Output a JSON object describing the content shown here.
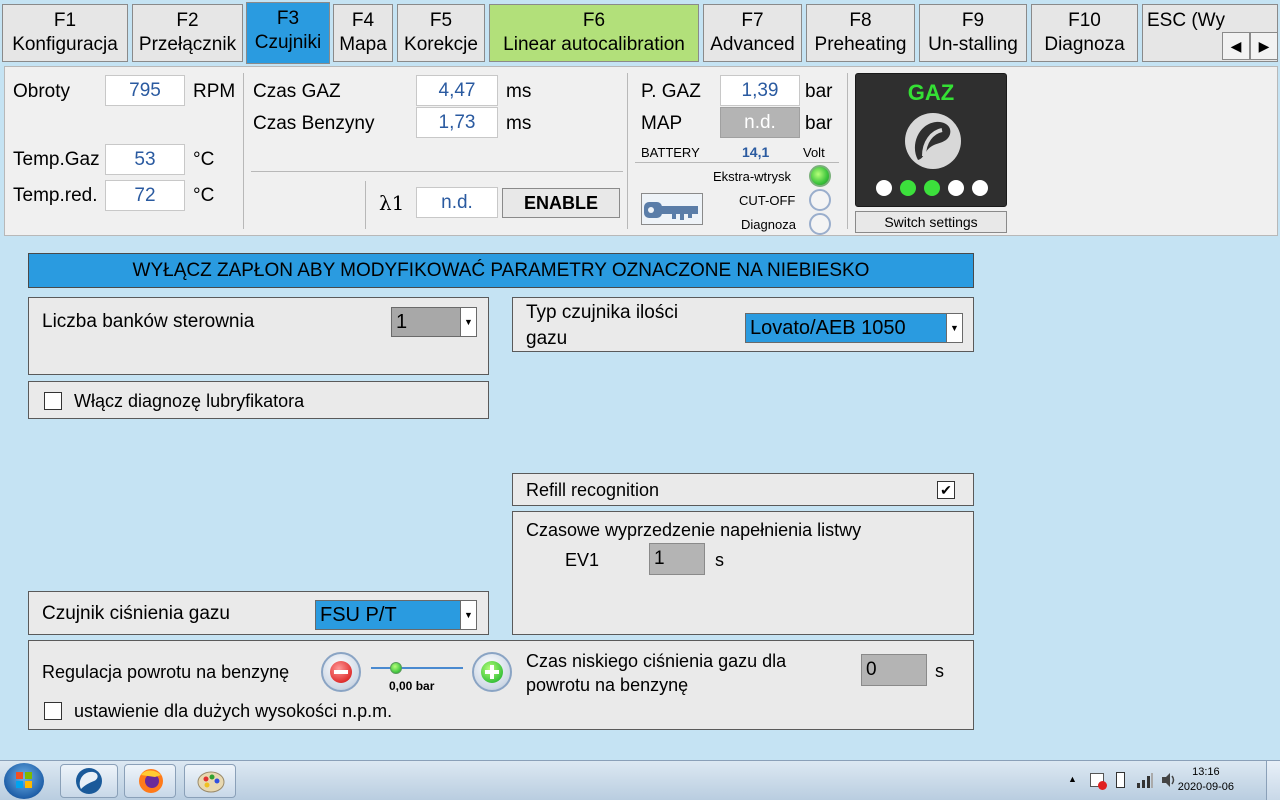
{
  "tabs": [
    {
      "key": "F1",
      "label": "Konfiguracja"
    },
    {
      "key": "F2",
      "label": "Przełącznik"
    },
    {
      "key": "F3",
      "label": "Czujniki"
    },
    {
      "key": "F4",
      "label": "Mapa"
    },
    {
      "key": "F5",
      "label": "Korekcje"
    },
    {
      "key": "F6",
      "label": "Linear autocalibration"
    },
    {
      "key": "F7",
      "label": "Advanced"
    },
    {
      "key": "F8",
      "label": "Preheating"
    },
    {
      "key": "F9",
      "label": "Un-stalling"
    },
    {
      "key": "F10",
      "label": "Diagnoza"
    },
    {
      "key": "ESC (Wy",
      "label": ""
    }
  ],
  "scroll": {
    "left": "◀",
    "right": "▶"
  },
  "status": {
    "rpm_label": "Obroty",
    "rpm_value": "795",
    "rpm_unit": "RPM",
    "temp_gaz_label": "Temp.Gaz",
    "temp_gaz_value": "53",
    "temp_gaz_unit": "°C",
    "temp_red_label": "Temp.red.",
    "temp_red_value": "72",
    "temp_red_unit": "°C",
    "czas_gaz_label": "Czas GAZ",
    "czas_gaz_value": "4,47",
    "czas_gaz_unit": "ms",
    "czas_benz_label": "Czas Benzyny",
    "czas_benz_value": "1,73",
    "czas_benz_unit": "ms",
    "lambda_label": "λ1",
    "lambda_value": "n.d.",
    "enable_label": "ENABLE",
    "p_gaz_label": "P. GAZ",
    "p_gaz_value": "1,39",
    "p_gaz_unit": "bar",
    "map_label": "MAP",
    "map_value": "n.d.",
    "map_unit": "bar",
    "battery_label": "BATTERY",
    "battery_value": "14,1",
    "battery_unit": "Volt",
    "ekstra_label": "Ekstra-wtrysk",
    "cutoff_label": "CUT-OFF",
    "diagnoza_label": "Diagnoza",
    "gaz_title": "GAZ",
    "switch_settings_label": "Switch settings"
  },
  "leds": {
    "ekstra": "on",
    "cutoff": "off",
    "diagnoza": "off"
  },
  "gaz_dots": [
    "off",
    "on",
    "on",
    "off",
    "off"
  ],
  "main": {
    "banner": "WYŁĄCZ ZAPŁON ABY MODYFIKOWAĆ PARAMETRY OZNACZONE NA NIEBIESKO",
    "banks_label": "Liczba banków sterownia",
    "banks_value": "1",
    "lubr_label": "Włącz diagnozę lubryfikatora",
    "sensor_type_label_1": "Typ czujnika ilości",
    "sensor_type_label_2": "gazu",
    "sensor_type_value": "Lovato/AEB 1050",
    "refill_label": "Refill recognition",
    "refill_checked": "✔",
    "advance_title": "Czasowe wyprzedzenie napełnienia listwy",
    "ev1_label": "EV1",
    "ev1_value": "1",
    "ev1_unit": "s",
    "pressure_sensor_label": "Czujnik ciśnienia gazu",
    "pressure_sensor_value": "FSU P/T",
    "return_label": "Regulacja powrotu na benzynę",
    "slider_value": "0,00 bar",
    "low_pressure_label_1": "Czas niskiego ciśnienia gazu dla",
    "low_pressure_label_2": "powrotu na benzynę",
    "low_pressure_value": "0",
    "low_pressure_unit": "s",
    "altitude_label": "ustawienie dla dużych wysokości n.p.m."
  },
  "taskbar": {
    "time": "13:16",
    "date": "2020-09-06",
    "tray_up": "▲"
  },
  "colors": {
    "accent_blue": "#2a9be0",
    "tab_green": "#b2e07a",
    "background": "#c5e3f3",
    "value_blue": "#2a5aa0"
  }
}
